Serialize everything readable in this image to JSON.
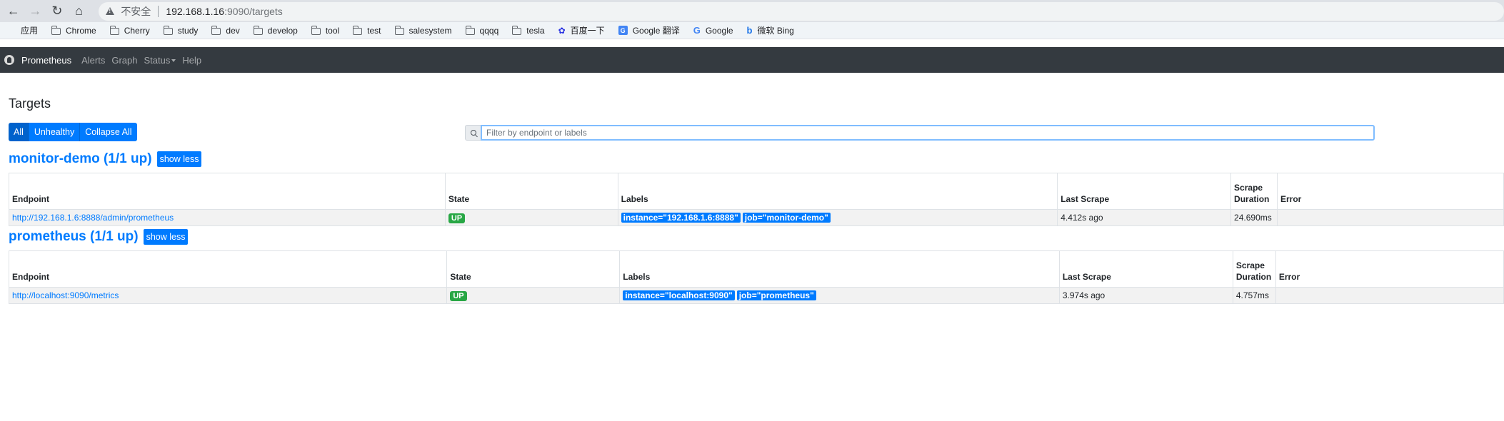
{
  "browser": {
    "insecure_label": "不安全",
    "url_host": "192.168.1.16",
    "url_path": ":9090/targets",
    "bookmarks": [
      {
        "label": "应用",
        "icon": "apps-icon"
      },
      {
        "label": "Chrome",
        "icon": "folder-icon"
      },
      {
        "label": "Cherry",
        "icon": "folder-icon"
      },
      {
        "label": "study",
        "icon": "folder-icon"
      },
      {
        "label": "dev",
        "icon": "folder-icon"
      },
      {
        "label": "develop",
        "icon": "folder-icon"
      },
      {
        "label": "tool",
        "icon": "folder-icon"
      },
      {
        "label": "test",
        "icon": "folder-icon"
      },
      {
        "label": "salesystem",
        "icon": "folder-icon"
      },
      {
        "label": "qqqq",
        "icon": "folder-icon"
      },
      {
        "label": "tesla",
        "icon": "folder-icon"
      },
      {
        "label": "百度一下",
        "icon": "baidu-icon"
      },
      {
        "label": "Google 翻译",
        "icon": "google-translate-icon"
      },
      {
        "label": "Google",
        "icon": "google-icon"
      },
      {
        "label": "微软 Bing",
        "icon": "bing-icon"
      }
    ]
  },
  "navbar": {
    "brand": "Prometheus",
    "links": [
      "Alerts",
      "Graph",
      "Status",
      "Help"
    ]
  },
  "page": {
    "title": "Targets",
    "filter_buttons": [
      "All",
      "Unhealthy",
      "Collapse All"
    ],
    "filter_placeholder": "Filter by endpoint or labels"
  },
  "table_headers": {
    "endpoint": "Endpoint",
    "state": "State",
    "labels": "Labels",
    "last_scrape": "Last Scrape",
    "scrape_duration_1": "Scrape",
    "scrape_duration_2": "Duration",
    "error": "Error"
  },
  "jobs": [
    {
      "title": "monitor-demo (1/1 up)",
      "toggle_label": "show less",
      "endpoint": "http://192.168.1.6:8888/admin/prometheus",
      "state": "UP",
      "labels": [
        "instance=\"192.168.1.6:8888\"",
        "job=\"monitor-demo\""
      ],
      "last_scrape": "4.412s ago",
      "duration": "24.690ms",
      "error": ""
    },
    {
      "title": "prometheus (1/1 up)",
      "toggle_label": "show less",
      "endpoint": "http://localhost:9090/metrics",
      "state": "UP",
      "labels": [
        "instance=\"localhost:9090\"",
        "job=\"prometheus\""
      ],
      "last_scrape": "3.974s ago",
      "duration": "4.757ms",
      "error": ""
    }
  ],
  "colors": {
    "primary": "#007bff",
    "success": "#28a745",
    "navbar": "#343a40"
  }
}
